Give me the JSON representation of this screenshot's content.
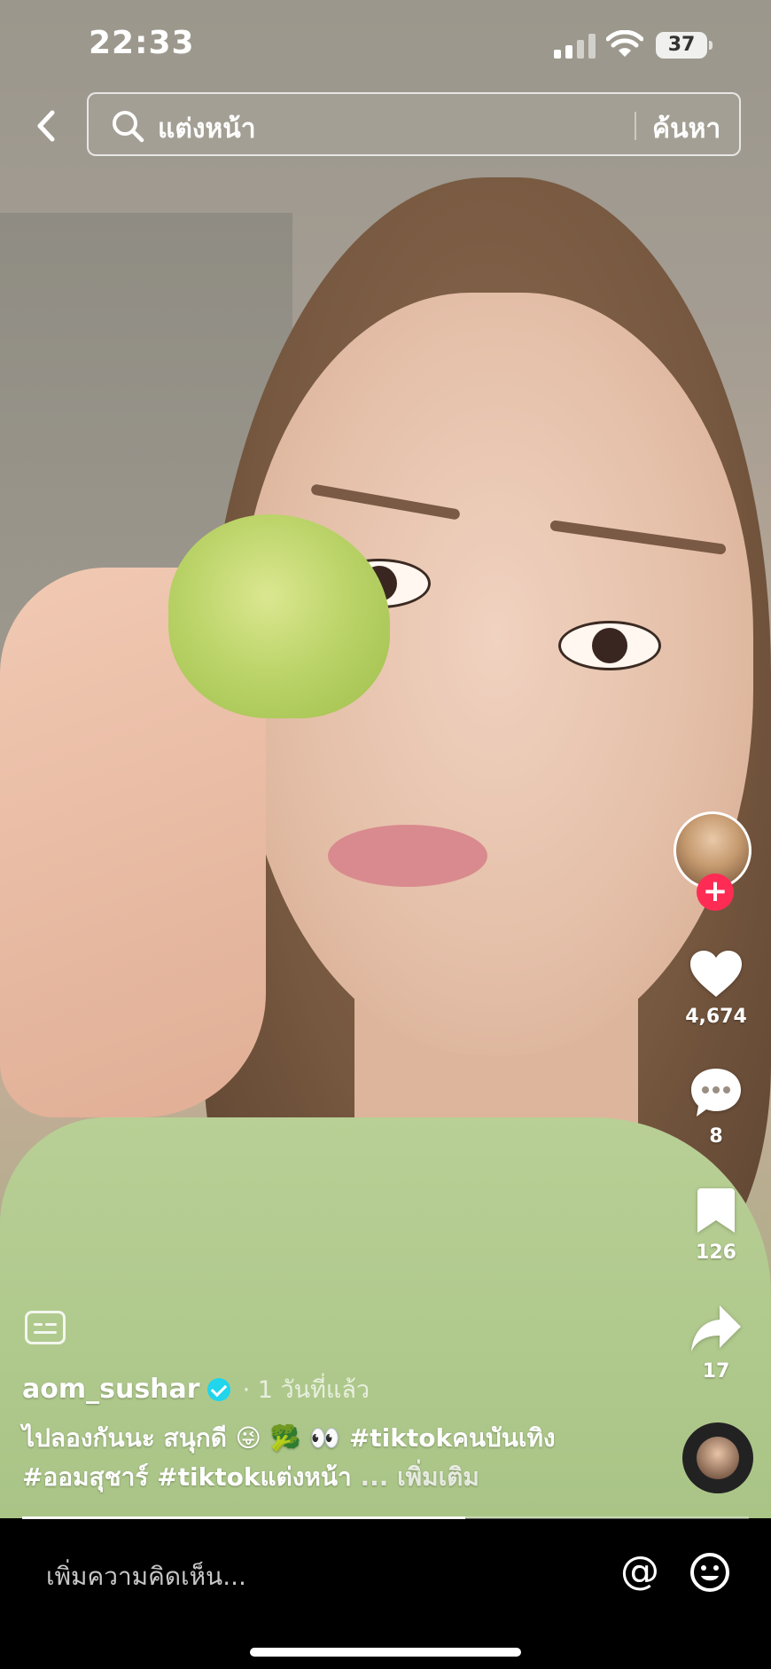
{
  "status_bar": {
    "time": "22:33",
    "battery": "37"
  },
  "search": {
    "query": "แต่งหน้า",
    "button_label": "ค้นหา"
  },
  "author": {
    "username": "aom_sushar",
    "date": "· 1 วันที่แล้ว"
  },
  "caption": {
    "text": "ไปลองกันนะ สนุกดี 😜 🥦 👀 ",
    "hashtags": [
      "#tiktokคนบันเทิง",
      "#ออมสุชาร์",
      "#tiktokแต่งหน้า"
    ],
    "more": "... เพิ่มเติม"
  },
  "actions": {
    "likes": "4,674",
    "comments": "8",
    "saves": "126",
    "shares": "17"
  },
  "comment_bar": {
    "placeholder": "เพิ่มความคิดเห็น...",
    "mention": "@"
  },
  "playback": {
    "progress": 0.61
  },
  "colors": {
    "follow_badge": "#fe2c55",
    "verified": "#20d5ec"
  }
}
